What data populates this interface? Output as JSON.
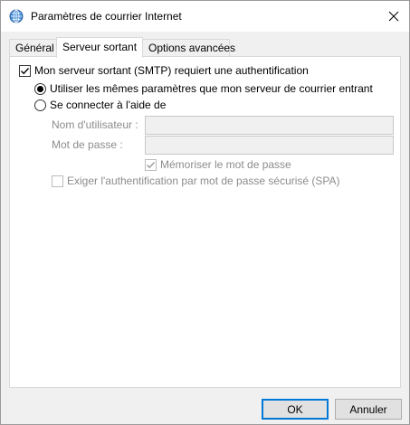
{
  "window": {
    "title": "Paramètres de courrier Internet",
    "icon": "globe-mail-icon"
  },
  "tabs": [
    {
      "label": "Général",
      "active": false
    },
    {
      "label": "Serveur sortant",
      "active": true
    },
    {
      "label": "Options avancées",
      "active": false
    }
  ],
  "outgoing": {
    "smtp_auth_label": "Mon serveur sortant (SMTP) requiert une authentification",
    "smtp_auth_checked": true,
    "use_same_label": "Utiliser les mêmes paramètres que mon serveur de courrier entrant",
    "use_same_selected": true,
    "login_with_label": "Se connecter à l'aide de",
    "login_with_selected": false,
    "username_label": "Nom d'utilisateur :",
    "username_value": "",
    "password_label": "Mot de passe :",
    "password_value": "",
    "remember_password_label": "Mémoriser le mot de passe",
    "remember_password_checked": true,
    "spa_label": "Exiger l'authentification par mot de passe sécurisé (SPA)",
    "spa_checked": false
  },
  "buttons": {
    "ok_label": "OK",
    "cancel_label": "Annuler"
  },
  "colors": {
    "accent": "#0078d7",
    "disabled_text": "#8c8c8c"
  }
}
